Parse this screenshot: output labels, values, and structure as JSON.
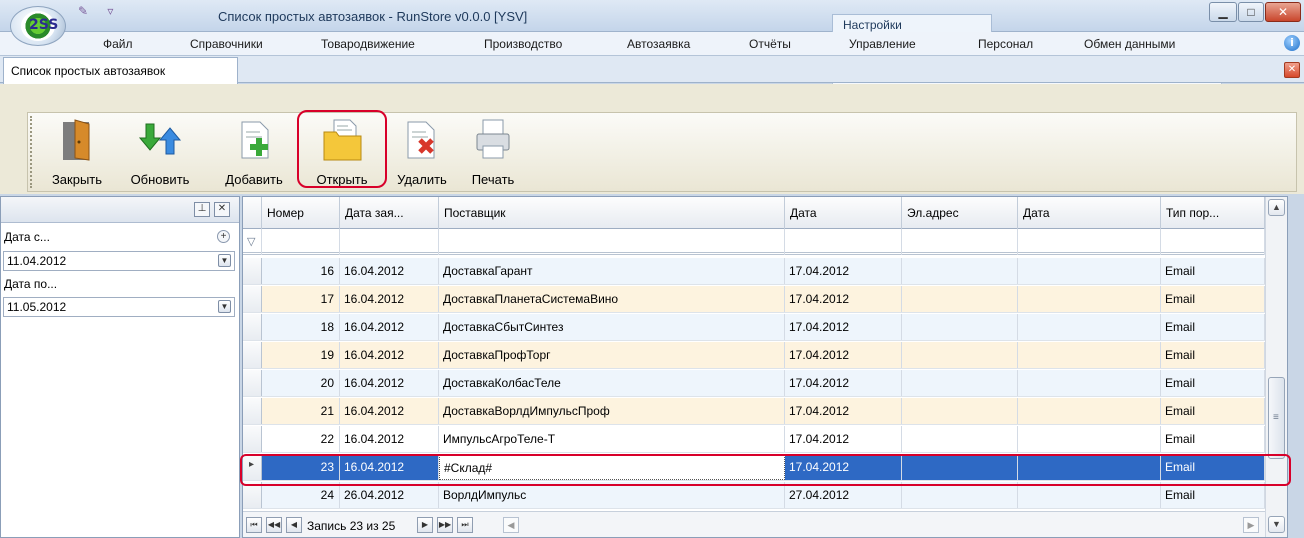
{
  "window": {
    "title": "Список простых автозаявок - RunStore v0.0.0 [YSV]",
    "context_tab": "Настройки",
    "logo_text": "2SS"
  },
  "menu": [
    "Файл",
    "Справочники",
    "Товародвижение",
    "Производство",
    "Автозаявка",
    "Отчёты",
    "Управление",
    "Персонал",
    "Обмен данными"
  ],
  "document_tab": {
    "label": "Список простых автозаявок"
  },
  "toolbar": {
    "close": "Закрыть",
    "refresh": "Обновить",
    "add": "Добавить",
    "open": "Открыть",
    "delete": "Удалить",
    "print": "Печать"
  },
  "filters": {
    "date_from_label": "Дата с...",
    "date_from_value": "11.04.2012",
    "date_to_label": "Дата по...",
    "date_to_value": "11.05.2012"
  },
  "grid": {
    "columns": [
      "Номер",
      "Дата зая...",
      "Поставщик",
      "Дата",
      "Эл.адрес",
      "Дата",
      "Тип пор..."
    ],
    "rows": [
      {
        "num": "16",
        "date": "16.04.2012",
        "supplier": "ДоставкаГарант",
        "date2": "17.04.2012",
        "email": "",
        "date3": "",
        "type": "Email"
      },
      {
        "num": "17",
        "date": "16.04.2012",
        "supplier": "ДоставкаПланетаСистемаВино",
        "date2": "17.04.2012",
        "email": "",
        "date3": "",
        "type": "Email"
      },
      {
        "num": "18",
        "date": "16.04.2012",
        "supplier": "ДоставкаСбытСинтез",
        "date2": "17.04.2012",
        "email": "",
        "date3": "",
        "type": "Email"
      },
      {
        "num": "19",
        "date": "16.04.2012",
        "supplier": "ДоставкаПрофТорг",
        "date2": "17.04.2012",
        "email": "",
        "date3": "",
        "type": "Email"
      },
      {
        "num": "20",
        "date": "16.04.2012",
        "supplier": "ДоставкаКолбасТеле",
        "date2": "17.04.2012",
        "email": "",
        "date3": "",
        "type": "Email"
      },
      {
        "num": "21",
        "date": "16.04.2012",
        "supplier": "ДоставкаВорлдИмпульсПроф",
        "date2": "17.04.2012",
        "email": "",
        "date3": "",
        "type": "Email"
      },
      {
        "num": "22",
        "date": "16.04.2012",
        "supplier": "ИмпульсАгроТеле-Т",
        "date2": "17.04.2012",
        "email": "",
        "date3": "",
        "type": "Email"
      },
      {
        "num": "23",
        "date": "16.04.2012",
        "supplier": "#Склад#",
        "date2": "17.04.2012",
        "email": "",
        "date3": "",
        "type": "Email"
      },
      {
        "num": "24",
        "date": "26.04.2012",
        "supplier": "ВорлдИмпульс",
        "date2": "27.04.2012",
        "email": "",
        "date3": "",
        "type": "Email"
      }
    ],
    "selected_index": 7,
    "record_nav": "Запись 23 из 25"
  },
  "colors": {
    "selection": "#2e69c4",
    "highlight_frame": "#d8002a",
    "row_alt": "#fdf3df",
    "row_light": "#eef5fc"
  }
}
